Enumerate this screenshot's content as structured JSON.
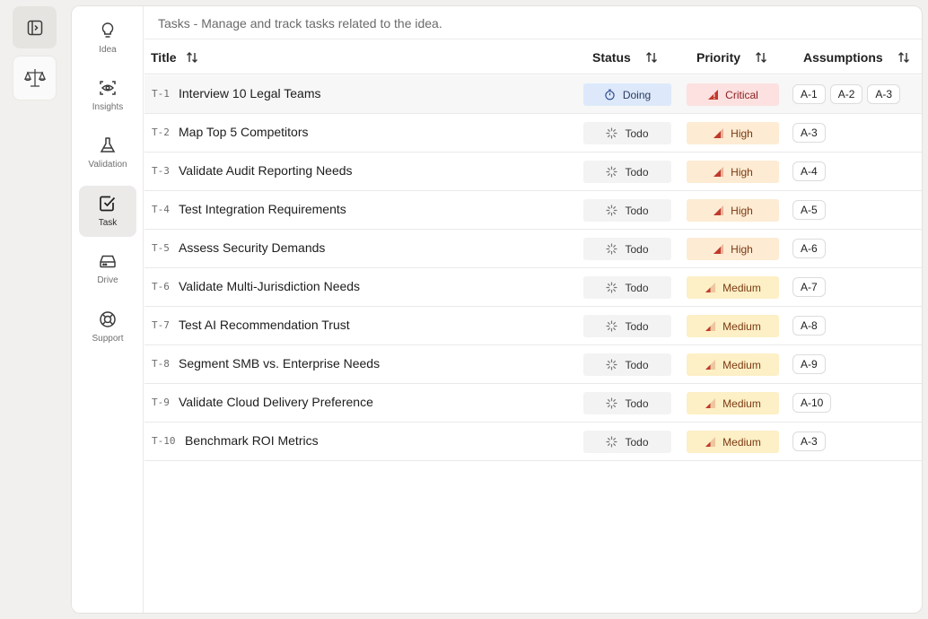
{
  "nav": {
    "items": [
      {
        "label": "Idea",
        "icon": "lightbulb-icon",
        "active": false
      },
      {
        "label": "Insights",
        "icon": "eye-scan-icon",
        "active": false
      },
      {
        "label": "Validation",
        "icon": "flask-icon",
        "active": false
      },
      {
        "label": "Task",
        "icon": "checkbox-icon",
        "active": true
      },
      {
        "label": "Drive",
        "icon": "hard-drive-icon",
        "active": false
      },
      {
        "label": "Support",
        "icon": "lifebuoy-icon",
        "active": false
      }
    ]
  },
  "header": {
    "subtitle": "Tasks - Manage and track tasks related to the idea."
  },
  "table": {
    "columns": {
      "title": "Title",
      "status": "Status",
      "priority": "Priority",
      "assumptions": "Assumptions"
    },
    "rows": [
      {
        "id": "T-1",
        "title": "Interview 10 Legal Teams",
        "status": "Doing",
        "priority": "Critical",
        "assumptions": [
          "A-1",
          "A-2",
          "A-3"
        ]
      },
      {
        "id": "T-2",
        "title": "Map Top 5 Competitors",
        "status": "Todo",
        "priority": "High",
        "assumptions": [
          "A-3"
        ]
      },
      {
        "id": "T-3",
        "title": "Validate Audit Reporting Needs",
        "status": "Todo",
        "priority": "High",
        "assumptions": [
          "A-4"
        ]
      },
      {
        "id": "T-4",
        "title": "Test Integration Requirements",
        "status": "Todo",
        "priority": "High",
        "assumptions": [
          "A-5"
        ]
      },
      {
        "id": "T-5",
        "title": "Assess Security Demands",
        "status": "Todo",
        "priority": "High",
        "assumptions": [
          "A-6"
        ]
      },
      {
        "id": "T-6",
        "title": "Validate Multi-Jurisdiction Needs",
        "status": "Todo",
        "priority": "Medium",
        "assumptions": [
          "A-7"
        ]
      },
      {
        "id": "T-7",
        "title": "Test AI Recommendation Trust",
        "status": "Todo",
        "priority": "Medium",
        "assumptions": [
          "A-8"
        ]
      },
      {
        "id": "T-8",
        "title": "Segment SMB vs. Enterprise Needs",
        "status": "Todo",
        "priority": "Medium",
        "assumptions": [
          "A-9"
        ]
      },
      {
        "id": "T-9",
        "title": "Validate Cloud Delivery Preference",
        "status": "Todo",
        "priority": "Medium",
        "assumptions": [
          "A-10"
        ]
      },
      {
        "id": "T-10",
        "title": "Benchmark ROI Metrics",
        "status": "Todo",
        "priority": "Medium",
        "assumptions": [
          "A-3"
        ]
      }
    ]
  },
  "colors": {
    "doing": "#dde9fb",
    "todo": "#f3f3f3",
    "critical": "#fde0e0",
    "high": "#fdebd3",
    "medium": "#fdefc6",
    "priority_icon": "#c0392b"
  }
}
